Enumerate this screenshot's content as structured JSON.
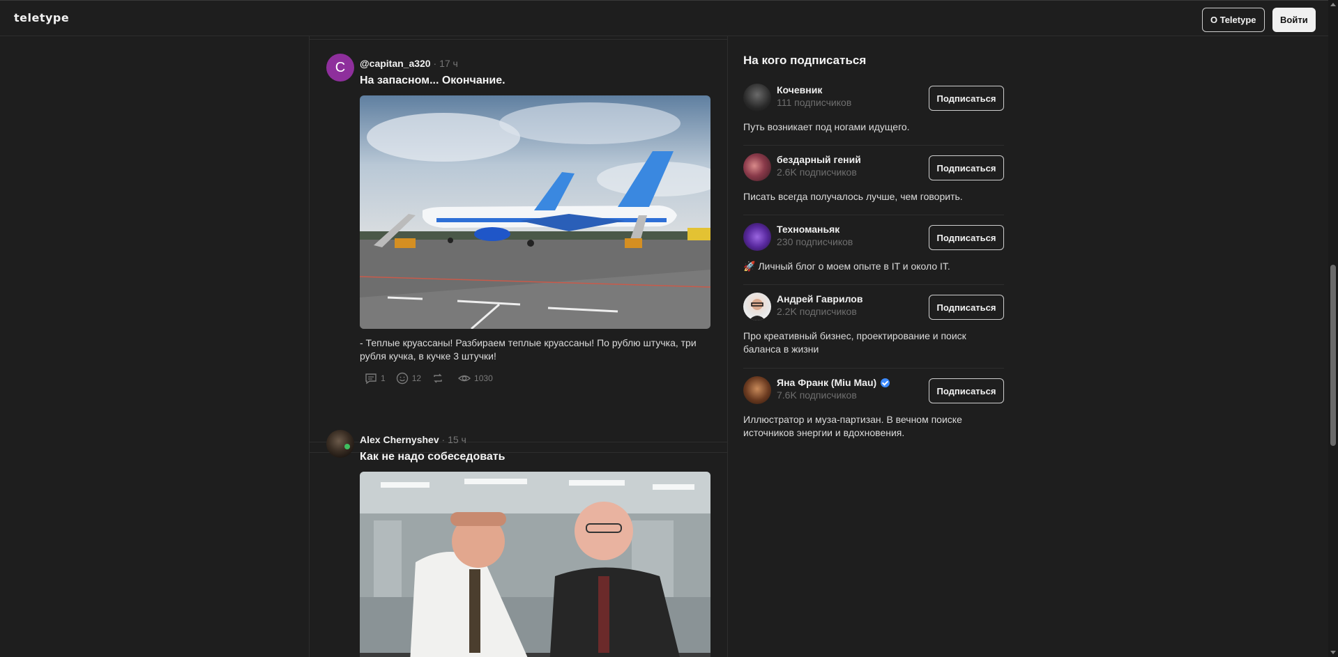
{
  "header": {
    "logo": "teletype",
    "about_label": "О Teletype",
    "login_label": "Войти"
  },
  "feed": {
    "posts": [
      {
        "avatar_letter": "C",
        "author": "@capitan_a320",
        "separator": "·",
        "time": "17 ч",
        "title": "На запасном... Окончание.",
        "text": "- Теплые круассаны! Разбираем теплые круассаны! По рублю штучка, три рубля кучка, в кучке 3 штучки!",
        "comments": "1",
        "reactions": "12",
        "views": "1030"
      },
      {
        "author": "Alex Chernyshev",
        "separator": "·",
        "time": "15 ч",
        "title": "Как не надо собеседовать"
      }
    ]
  },
  "sidebar": {
    "title": "На кого подписаться",
    "follow_label": "Подписаться",
    "recommendations": [
      {
        "name": "Кочевник",
        "subscribers": "111 подписчиков",
        "description": "Путь возникает под ногами идущего."
      },
      {
        "name": "бездарный гений",
        "subscribers": "2.6K подписчиков",
        "description": "Писать всегда получалось лучше, чем говорить."
      },
      {
        "name": "Техноманьяк",
        "subscribers": "230 подписчиков",
        "description": "🚀 Личный блог о моем опыте в IT и около IT."
      },
      {
        "name": "Андрей Гаврилов",
        "subscribers": "2.2K подписчиков",
        "description": "Про креативный бизнес, проектирование и поиск баланса в жизни"
      },
      {
        "name": "Яна Франк (Miu Mau)",
        "subscribers": "7.6K подписчиков",
        "description": "Иллюстратор и муза-партизан. В вечном поиске источников энергии и вдохновения.",
        "verified": true
      }
    ]
  },
  "colors": {
    "background": "#1e1e1e",
    "accent_avatar": "#8e2f9c",
    "verified": "#3d8bff"
  }
}
